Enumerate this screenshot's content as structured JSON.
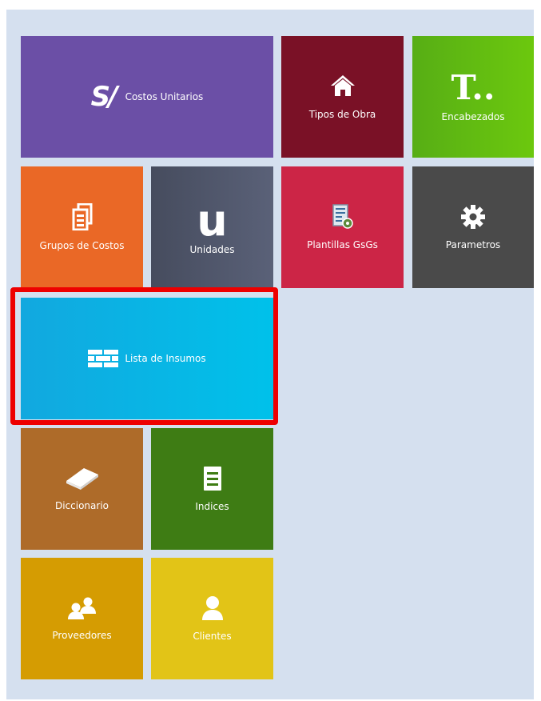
{
  "tiles": {
    "costos_unitarios": {
      "label": "Costos Unitarios",
      "symbol": "S/",
      "icon": "currency-sol-icon",
      "color": "#6b4fa6"
    },
    "tipos_de_obra": {
      "label": "Tipos de Obra",
      "icon": "home-icon",
      "color": "#7a1126"
    },
    "encabezados": {
      "label": "Encabezados",
      "symbol": "T..",
      "icon": "text-header-icon",
      "color": "#6cc80e"
    },
    "grupos_de_costos": {
      "label": "Grupos de Costos",
      "icon": "documents-icon",
      "color": "#ea6826"
    },
    "unidades": {
      "label": "Unidades",
      "symbol": "u",
      "icon": "unit-letter-icon",
      "color": "#5a6178"
    },
    "plantillas_gsgs": {
      "label": "Plantillas GsGs",
      "icon": "template-settings-icon",
      "color": "#cc2546"
    },
    "parametros": {
      "label": "Parametros",
      "icon": "gear-icon",
      "color": "#4a4a4a"
    },
    "lista_de_insumos": {
      "label": "Lista de Insumos",
      "icon": "brick-wall-icon",
      "color": "#00c1ea"
    },
    "diccionario": {
      "label": "Diccionario",
      "icon": "book-icon",
      "color": "#ae6b29"
    },
    "indices": {
      "label": "Indices",
      "icon": "list-document-icon",
      "color": "#3e7c14"
    },
    "proveedores": {
      "label": "Proveedores",
      "icon": "users-icon",
      "color": "#d59c02"
    },
    "clientes": {
      "label": "Clientes",
      "icon": "user-icon",
      "color": "#e2c417"
    }
  },
  "highlight": {
    "target": "lista_de_insumos",
    "color": "#ee0000"
  }
}
